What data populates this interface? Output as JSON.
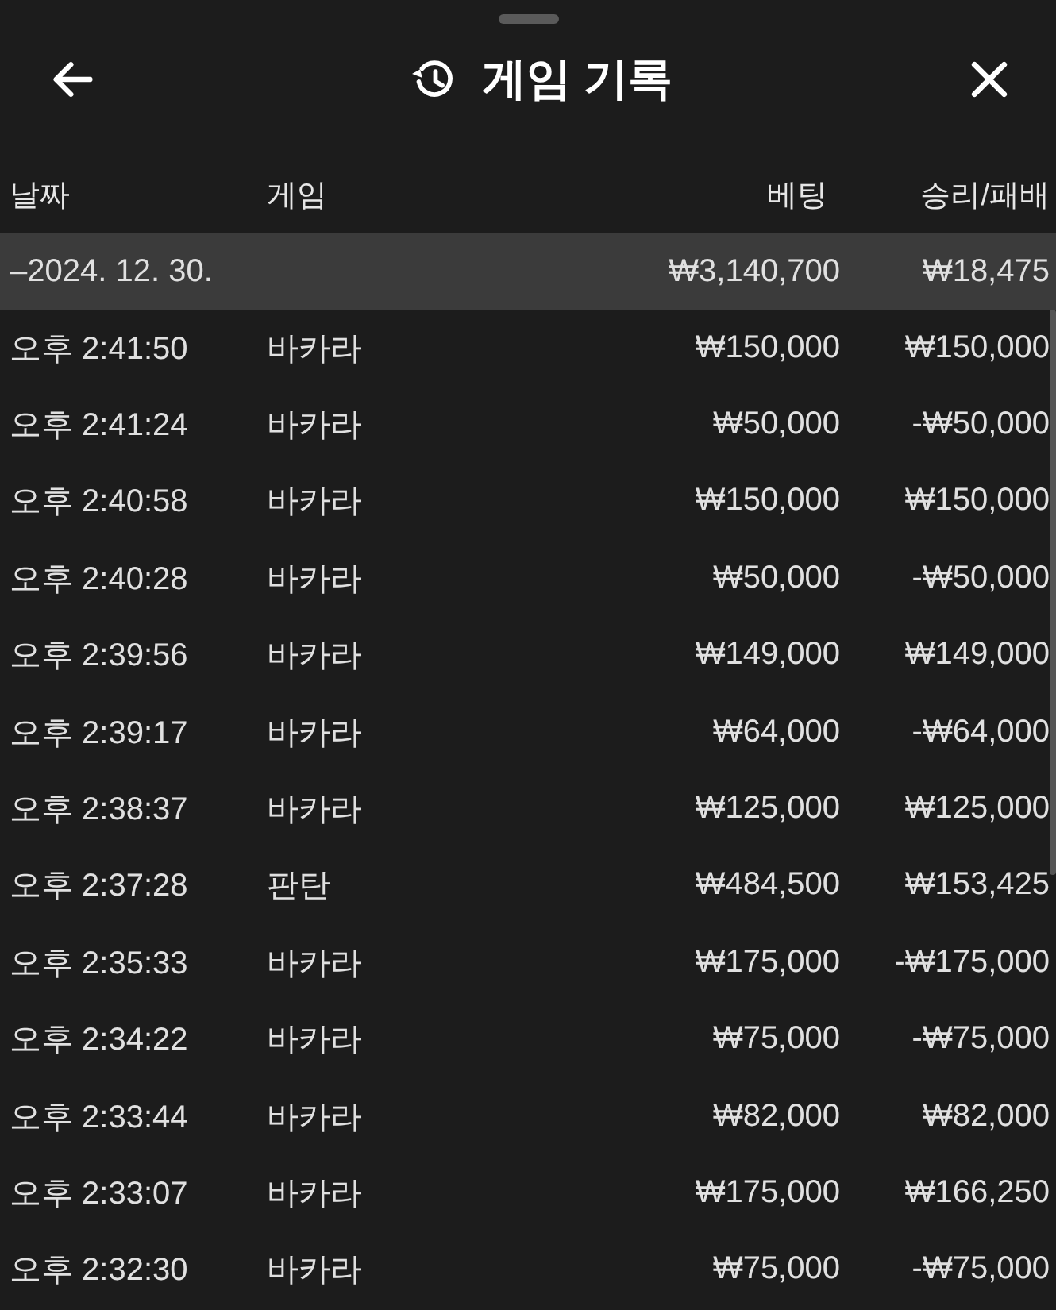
{
  "header": {
    "title": "게임 기록"
  },
  "table": {
    "columns": [
      "날짜",
      "게임",
      "베팅",
      "승리/패배"
    ],
    "groups": [
      {
        "label": "–2024. 12. 30.",
        "bet_total": "₩3,140,700",
        "result_total": "₩18,475",
        "rows": [
          {
            "time": "오후 2:41:50",
            "game": "바카라",
            "bet": "₩150,000",
            "result": "₩150,000"
          },
          {
            "time": "오후 2:41:24",
            "game": "바카라",
            "bet": "₩50,000",
            "result": "-₩50,000"
          },
          {
            "time": "오후 2:40:58",
            "game": "바카라",
            "bet": "₩150,000",
            "result": "₩150,000"
          },
          {
            "time": "오후 2:40:28",
            "game": "바카라",
            "bet": "₩50,000",
            "result": "-₩50,000"
          },
          {
            "time": "오후 2:39:56",
            "game": "바카라",
            "bet": "₩149,000",
            "result": "₩149,000"
          },
          {
            "time": "오후 2:39:17",
            "game": "바카라",
            "bet": "₩64,000",
            "result": "-₩64,000"
          },
          {
            "time": "오후 2:38:37",
            "game": "바카라",
            "bet": "₩125,000",
            "result": "₩125,000"
          },
          {
            "time": "오후 2:37:28",
            "game": "판탄",
            "bet": "₩484,500",
            "result": "₩153,425"
          },
          {
            "time": "오후 2:35:33",
            "game": "바카라",
            "bet": "₩175,000",
            "result": "-₩175,000"
          },
          {
            "time": "오후 2:34:22",
            "game": "바카라",
            "bet": "₩75,000",
            "result": "-₩75,000"
          },
          {
            "time": "오후 2:33:44",
            "game": "바카라",
            "bet": "₩82,000",
            "result": "₩82,000"
          },
          {
            "time": "오후 2:33:07",
            "game": "바카라",
            "bet": "₩175,000",
            "result": "₩166,250"
          },
          {
            "time": "오후 2:32:30",
            "game": "바카라",
            "bet": "₩75,000",
            "result": "-₩75,000"
          }
        ]
      }
    ]
  }
}
